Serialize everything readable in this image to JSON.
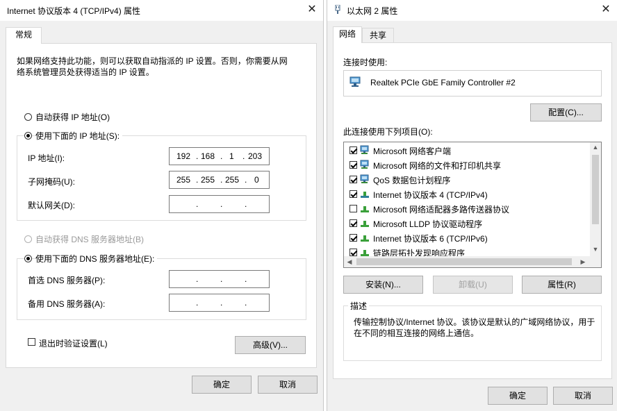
{
  "left_dialog": {
    "title": "Internet 协议版本 4 (TCP/IPv4) 属性",
    "tab_general": "常规",
    "description": "如果网络支持此功能，则可以获取自动指派的 IP 设置。否则，你需要从网络系统管理员处获得适当的 IP 设置。",
    "radio_auto_ip": "自动获得 IP 地址(O)",
    "radio_manual_ip": "使用下面的 IP 地址(S):",
    "label_ip": "IP 地址(I):",
    "label_mask": "子网掩码(U):",
    "label_gateway": "默认网关(D):",
    "ip": [
      "192",
      "168",
      "1",
      "203"
    ],
    "mask": [
      "255",
      "255",
      "255",
      "0"
    ],
    "dot": ".",
    "radio_auto_dns": "自动获得 DNS 服务器地址(B)",
    "radio_manual_dns": "使用下面的 DNS 服务器地址(E):",
    "label_dns1": "首选 DNS 服务器(P):",
    "label_dns2": "备用 DNS 服务器(A):",
    "validate_on_exit": "退出时验证设置(L)",
    "advanced_button": "高级(V)...",
    "ok_button": "确定",
    "cancel_button": "取消"
  },
  "right_dialog": {
    "title": "以太网 2 属性",
    "tab_network": "网络",
    "tab_sharing": "共享",
    "connect_using_label": "连接时使用:",
    "adapter_name": "Realtek PCIe GbE Family Controller #2",
    "configure_button": "配置(C)...",
    "items_label": "此连接使用下列项目(O):",
    "items": [
      {
        "label": "Microsoft 网络客户端",
        "checked": true,
        "icon": "network-client-icon"
      },
      {
        "label": "Microsoft 网络的文件和打印机共享",
        "checked": true,
        "icon": "network-client-icon"
      },
      {
        "label": "QoS 数据包计划程序",
        "checked": true,
        "icon": "network-service-icon"
      },
      {
        "label": "Internet 协议版本 4 (TCP/IPv4)",
        "checked": true,
        "icon": "protocol-icon"
      },
      {
        "label": "Microsoft 网络适配器多路传送器协议",
        "checked": false,
        "icon": "protocol-icon"
      },
      {
        "label": "Microsoft LLDP 协议驱动程序",
        "checked": true,
        "icon": "protocol-icon"
      },
      {
        "label": "Internet 协议版本 6 (TCP/IPv6)",
        "checked": true,
        "icon": "protocol-icon"
      },
      {
        "label": "链路层拓扑发现响应程序",
        "checked": true,
        "icon": "protocol-icon"
      }
    ],
    "install_button": "安装(N)...",
    "uninstall_button": "卸载(U)",
    "properties_button": "属性(R)",
    "description_group": "描述",
    "description_text": "传输控制协议/Internet 协议。该协议是默认的广域网络协议，用于在不同的相互连接的网络上通信。",
    "ok_button": "确定",
    "cancel_button": "取消"
  },
  "icons": {
    "close": "close-icon",
    "window": "network-adapter-icon"
  }
}
